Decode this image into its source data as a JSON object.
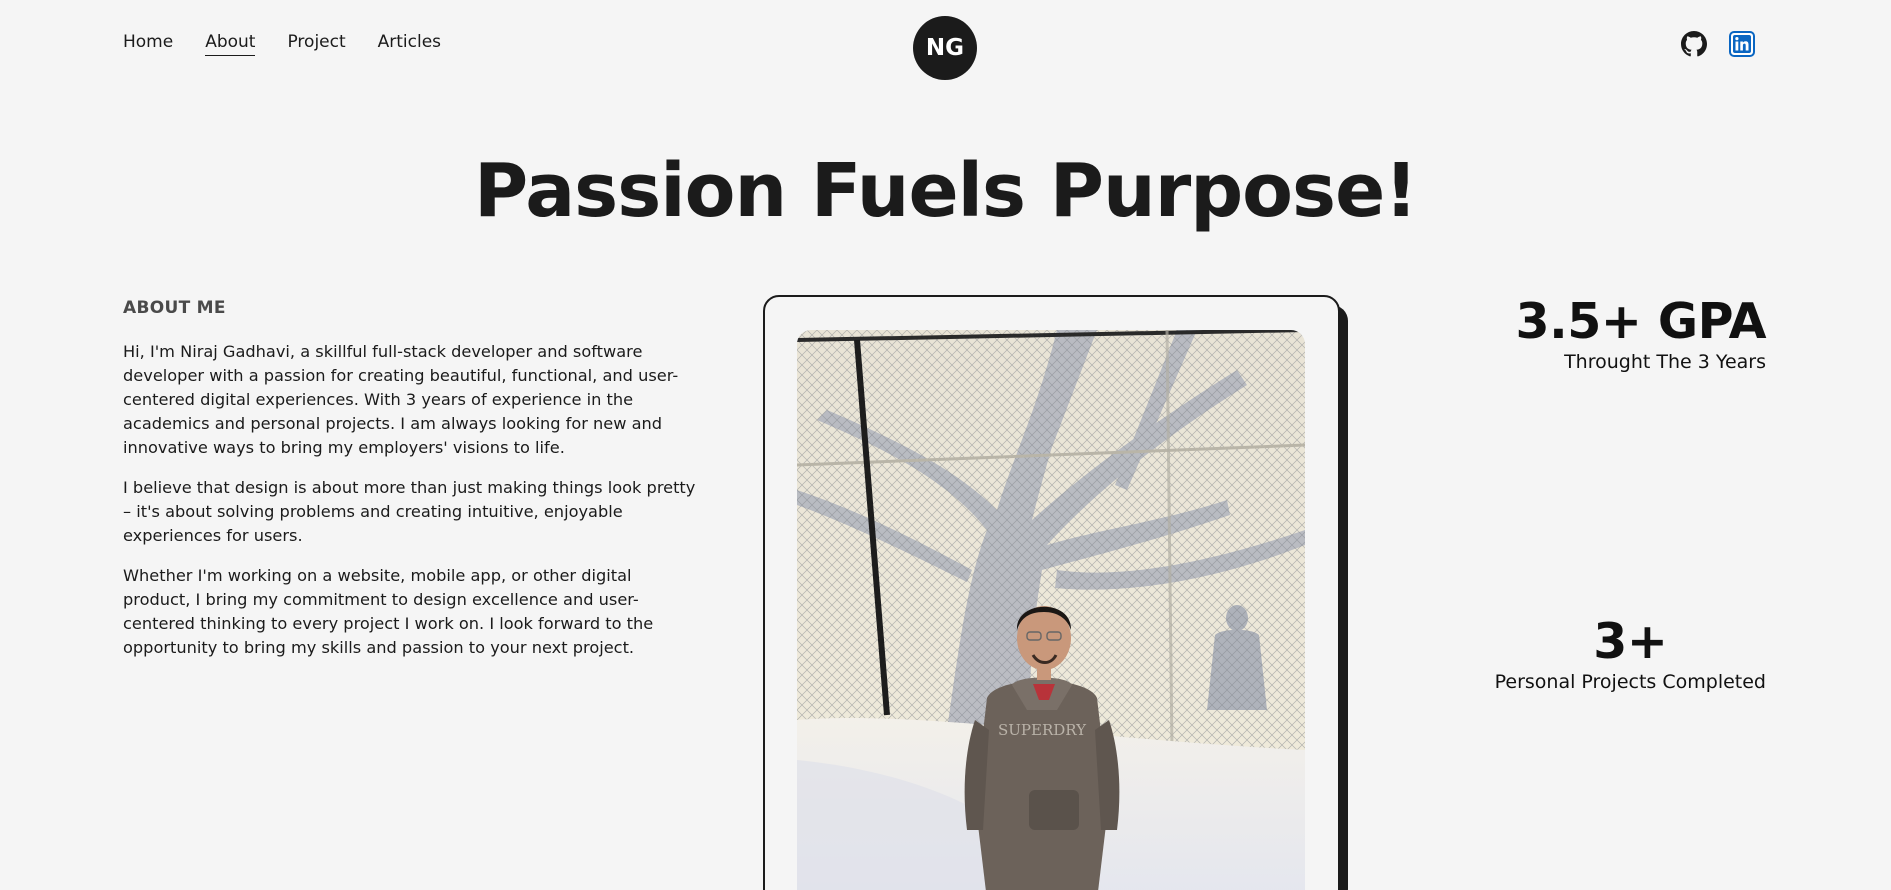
{
  "nav": {
    "items": [
      {
        "label": "Home"
      },
      {
        "label": "About",
        "active": true
      },
      {
        "label": "Project"
      },
      {
        "label": "Articles"
      }
    ]
  },
  "logo": {
    "text": "NG"
  },
  "socials": [
    {
      "icon": "github-icon"
    },
    {
      "icon": "linkedin-icon",
      "color": "#0a66c2"
    }
  ],
  "hero": {
    "headline": "Passion Fuels Purpose!"
  },
  "about": {
    "heading": "ABOUT ME",
    "paragraphs": [
      "Hi, I'm Niraj Gadhavi, a skillful full-stack developer and software developer with a passion for creating beautiful, functional, and user-centered digital experiences. With 3 years of experience in the academics and personal projects. I am always looking for new and innovative ways to bring my employers' visions to life.",
      "I believe that design is about more than just making things look pretty – it's about solving problems and creating intuitive, enjoyable experiences for users.",
      "Whether I'm working on a website, mobile app, or other digital product, I bring my commitment to design excellence and user-centered thinking to every project I work on. I look forward to the opportunity to bring my skills and passion to your next project."
    ]
  },
  "stats": [
    {
      "value": "3.5+ GPA",
      "label": "Throught The 3 Years"
    },
    {
      "value": "3+",
      "label": "Personal Projects Completed"
    }
  ],
  "colors": {
    "background": "#f5f5f5",
    "text": "#1b1b1b",
    "linkedin": "#0a66c2"
  }
}
